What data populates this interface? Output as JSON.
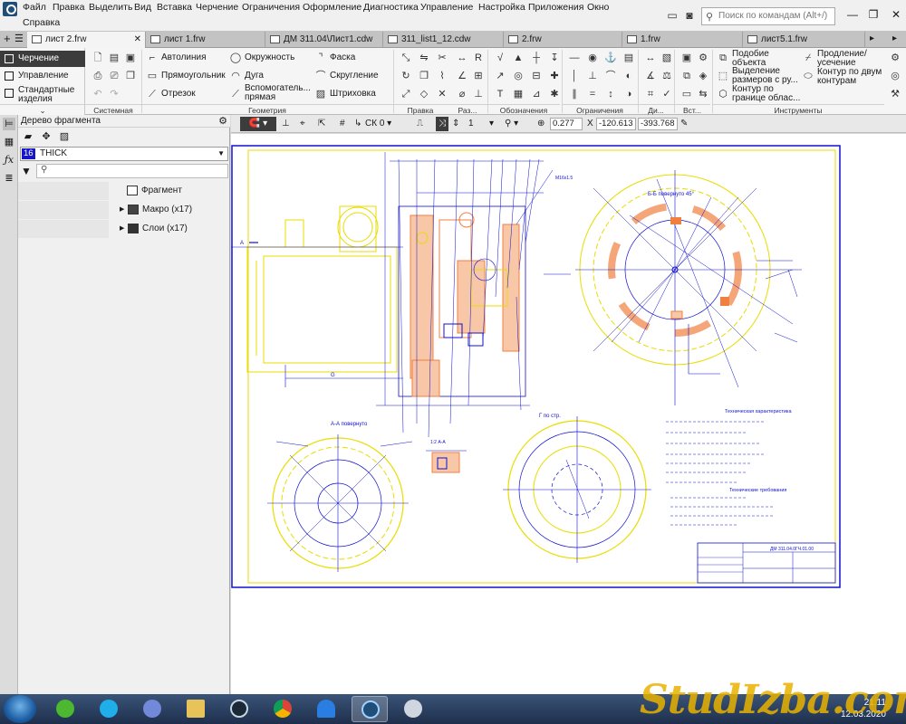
{
  "menu": {
    "row1": [
      "Файл",
      "Правка",
      "Выделить",
      "Вид",
      "Вставка",
      "Черчение",
      "Ограничения",
      "Оформление",
      "Диагностика",
      "Управление",
      "Настройка",
      "Приложения",
      "Окно"
    ],
    "row2": [
      "Справка"
    ],
    "search_placeholder": "Поиск по командам (Alt+/)"
  },
  "tabs": [
    {
      "label": "лист 2.frw",
      "active": true
    },
    {
      "label": "лист 1.frw"
    },
    {
      "label": "ДМ 311.04\\Лист1.cdw"
    },
    {
      "label": "311_list1_12.cdw"
    },
    {
      "label": "2.frw"
    },
    {
      "label": "1.frw"
    },
    {
      "label": "лист5.1.frw"
    }
  ],
  "ribbon": {
    "modes": [
      "Черчение",
      "Управление",
      "Стандартные изделия"
    ],
    "geometry": {
      "col1": [
        "Автолиния",
        "Прямоугольник",
        "Отрезок"
      ],
      "col2": [
        "Окружность",
        "Дуга",
        "Вспомогатель... прямая"
      ],
      "col3": [
        "Фаска",
        "Скругление",
        "Штриховка"
      ]
    },
    "tools": {
      "a": "Подобие объекта",
      "b": "Выделение размеров с ру...",
      "c": "Контур по границе облас...",
      "d": "Продление/ усечение",
      "e": "Контур по двум контурам"
    },
    "groups": [
      "Системная",
      "Геометрия",
      "Правка",
      "Раз...",
      "Обозначения",
      "Ограничения",
      "Ди...",
      "Вст...",
      "Инструменты"
    ]
  },
  "tree": {
    "title": "Дерево фрагмента",
    "layer_number": "16",
    "layer_name": "THICK",
    "items": [
      {
        "label": "Фрагмент"
      },
      {
        "label": "Макро (x17)"
      },
      {
        "label": "Слои (x17)"
      }
    ]
  },
  "canvas_toolbar": {
    "cs": "СК 0",
    "step": "1",
    "zoom": "0.277",
    "x_label": "X",
    "x_value": "-120.613",
    "y_value": "-393.768"
  },
  "drawing": {
    "title_block_code": "ДМ 311.04.0ГЧ.01.00",
    "section_aa": "А-А повернуто",
    "section_bb": "Б-Б повернуто 45°",
    "view_g": "Г по стр.",
    "tech_title": "Техническая характеристика",
    "req_title": "Технические требования"
  },
  "taskbar": {
    "time": "21:11",
    "date": "12.03.2020"
  },
  "watermark": "StudIzba.com",
  "colors": {
    "drawing_blue": "#1010d0",
    "drawing_yellow": "#e8dd00",
    "hatch_orange": "#f08040",
    "layer_badge": "#1717c8"
  }
}
